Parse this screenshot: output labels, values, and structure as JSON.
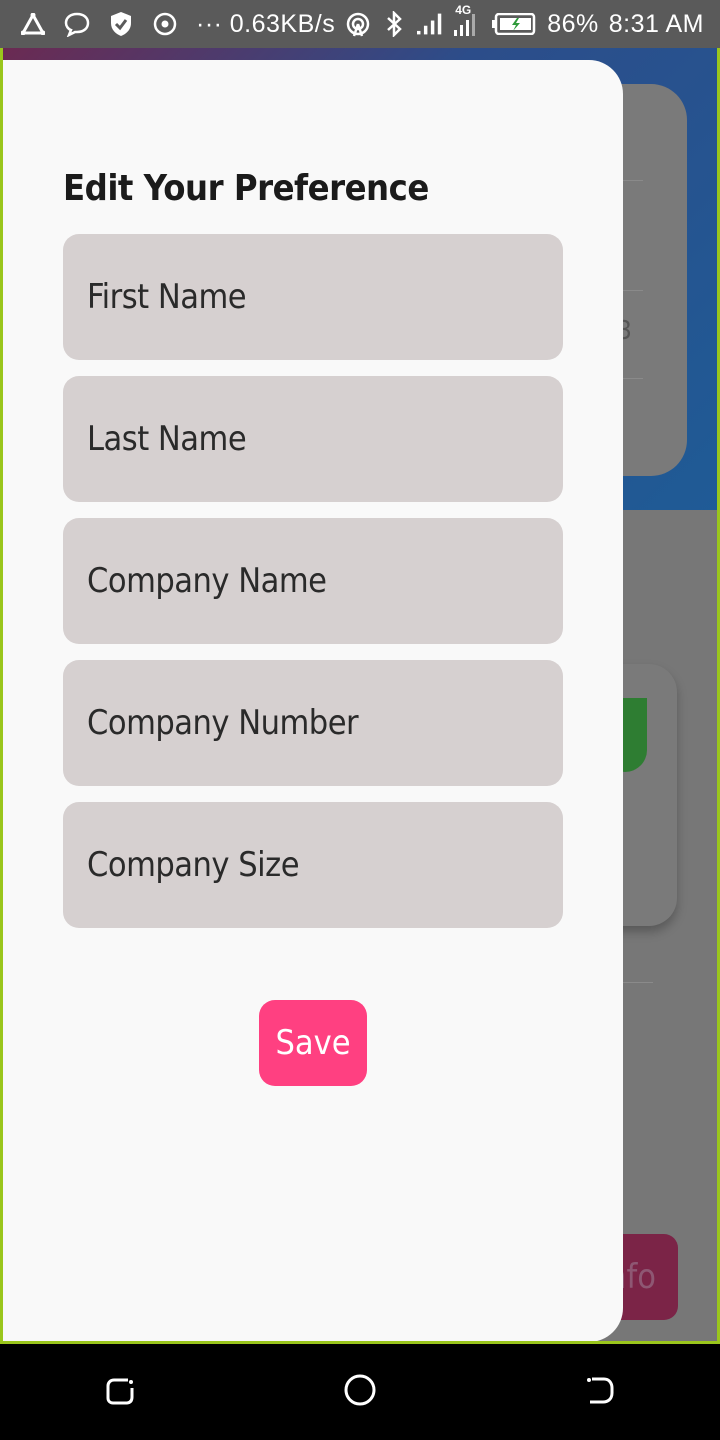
{
  "status_bar": {
    "network_speed": "0.63KB/s",
    "network_type": "4G",
    "battery": "86%",
    "time": "8:31 AM",
    "more_indicator": "···"
  },
  "background": {
    "card_number": "3",
    "info_button_label": "nfo"
  },
  "drawer": {
    "title": "Edit Your Preference",
    "fields": {
      "first_name": "First Name",
      "last_name": "Last Name",
      "company_name": "Company Name",
      "company_number": "Company Number",
      "company_size": "Company Size"
    },
    "save_label": "Save"
  },
  "colors": {
    "accent": "#ff4081",
    "field_bg": "#d6d0d0",
    "frame_border": "#9ac61c"
  },
  "icons": {
    "status_left": [
      "triangle-icon",
      "chat-bubble-icon",
      "shield-icon",
      "target-icon"
    ],
    "status_right": [
      "hotspot-icon",
      "bluetooth-icon",
      "signal-icon",
      "signal-4g-icon",
      "battery-charging-icon"
    ],
    "nav": [
      "recents-icon",
      "home-icon",
      "back-icon"
    ]
  }
}
